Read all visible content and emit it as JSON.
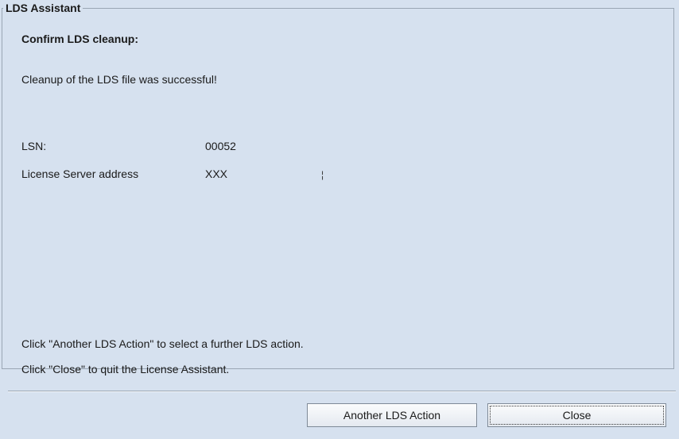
{
  "window": {
    "title": "LDS Assistant"
  },
  "content": {
    "heading": "Confirm LDS cleanup:",
    "message": "Cleanup of the LDS file was successful!",
    "details": [
      {
        "label": "LSN:",
        "value": "00052"
      },
      {
        "label": "License Server address",
        "value": "XXX"
      }
    ],
    "extra_mark": "¦",
    "instructions": [
      "Click \"Another LDS Action\" to select a further LDS action.",
      "Click \"Close\" to quit the License Assistant."
    ]
  },
  "buttons": {
    "another_label": "Another LDS Action",
    "close_label": "Close"
  }
}
